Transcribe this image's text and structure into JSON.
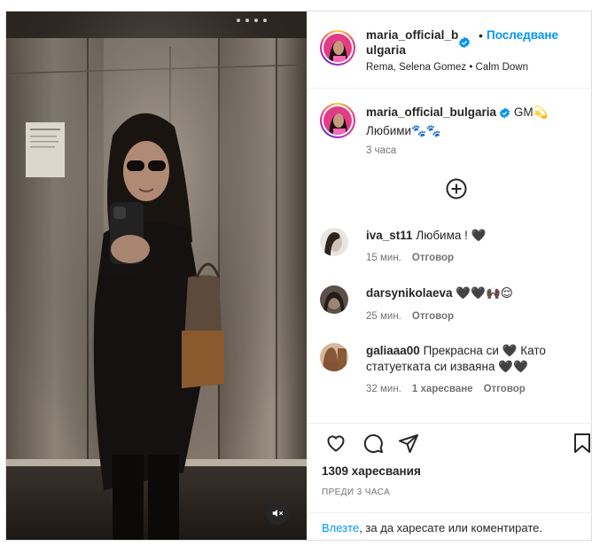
{
  "post": {
    "username": "maria_official_bulgaria",
    "username_line1": "maria_official_b",
    "username_line2": "ulgaria",
    "follow_separator": "•",
    "follow_label": "Последване",
    "audio": "Rema, Selena Gomez • Calm Down",
    "caption_text": "GM💫 Любими🐾🐾",
    "caption_time": "3 часа",
    "likes": "1309 харесвания",
    "posted_ago": "ПРЕДИ 3 ЧАСА",
    "login_link": "Влезте",
    "login_rest": ", за да харесате или коментирате."
  },
  "comments": [
    {
      "user": "iva_st11",
      "text": "Любима ! 🖤",
      "time": "15 мин.",
      "likes": "",
      "reply": "Отговор"
    },
    {
      "user": "darsynikolaeva",
      "text": "🖤🖤🙌🏿😌",
      "time": "25 мин.",
      "likes": "",
      "reply": "Отговор"
    },
    {
      "user": "galiaaa00",
      "text": "Прекрасна си 🖤 Като статуетката си изваяна 🖤🖤",
      "time": "32 мин.",
      "likes": "1 харесване",
      "reply": "Отговор"
    }
  ],
  "icons": {
    "verified": "verified-badge-icon",
    "add_comment": "plus-circle-icon",
    "like": "heart-icon",
    "comment": "speech-bubble-icon",
    "share": "paper-plane-icon",
    "save": "bookmark-icon",
    "mute": "speaker-muted-icon"
  },
  "colors": {
    "accent": "#0095f6",
    "text": "#262626",
    "muted": "#737373",
    "border": "#dbdbdb"
  }
}
